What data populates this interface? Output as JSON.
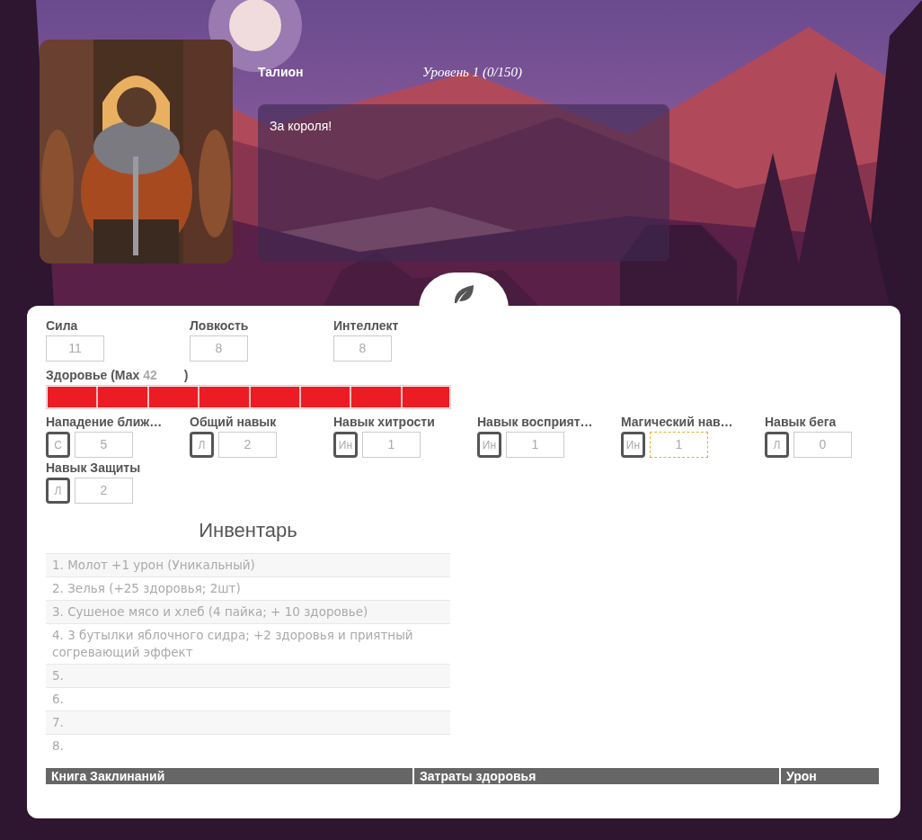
{
  "hero": {
    "name": "Талион",
    "level": "Уровень 1 (0/150)",
    "quote": "За короля!"
  },
  "stats": [
    {
      "label": "Сила",
      "value": "11"
    },
    {
      "label": "Ловкость",
      "value": "8"
    },
    {
      "label": "Интеллект",
      "value": "8"
    }
  ],
  "health": {
    "label": "Здоровье (Мах",
    "max": "42",
    "close": ")",
    "level": 1
  },
  "skills": [
    {
      "label": "Нападение ближ…",
      "attribute": "С",
      "value": "5",
      "focused": false
    },
    {
      "label": "Общий навык",
      "attribute": "Л",
      "value": "2",
      "focused": false
    },
    {
      "label": "Навык хитрости",
      "attribute": "Ин",
      "value": "1",
      "focused": false
    },
    {
      "label": "Навык восприят…",
      "attribute": "Ин",
      "value": "1",
      "focused": false
    },
    {
      "label": "Магический нав…",
      "attribute": "Ин",
      "value": "1",
      "focused": true
    },
    {
      "label": "Навык бега",
      "attribute": "Л",
      "value": "0",
      "focused": false
    },
    {
      "label": "Навык Защиты",
      "attribute": "Л",
      "value": "2",
      "focused": false
    }
  ],
  "inventory": {
    "title": "Инвентарь",
    "items": [
      "1. Молот +1 урон (Уникальный)",
      "2. Зелья (+25 здоровья; 2шт)",
      "3. Сушеное мясо и хлеб (4 пайка; + 10 здоровье)",
      "4. 3 бутылки яблочного сидра; +2 здоровья и приятный согревающий эффект",
      "5.",
      "6.",
      "7.",
      "8."
    ]
  },
  "spellbook": {
    "columns": [
      "Книга Заклинаний",
      "Затраты здоровья",
      "Урон"
    ]
  }
}
